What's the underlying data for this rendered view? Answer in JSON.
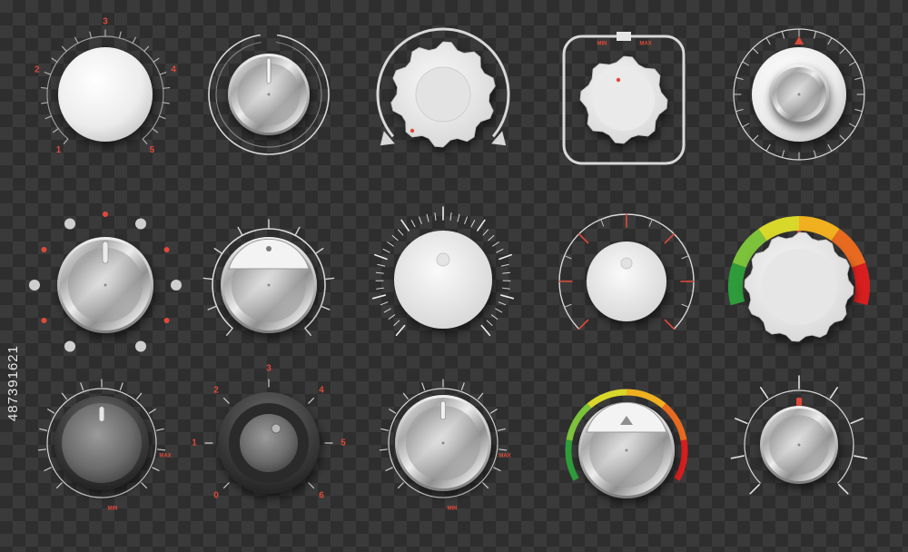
{
  "watermark": "487391621",
  "colors": {
    "accent_red": "#e04a3a",
    "ring": "#d8d8d8",
    "gauge": [
      "#2e9c3a",
      "#7cc23a",
      "#d8d82a",
      "#f0b020",
      "#e86a20",
      "#d81e1e"
    ]
  },
  "knobs": [
    {
      "id": "knob-1-1",
      "style": "white-numbered",
      "scale_labels": [
        "1",
        "2",
        "3",
        "4",
        "5"
      ]
    },
    {
      "id": "knob-1-2",
      "style": "chrome-ring-indicator"
    },
    {
      "id": "knob-1-3",
      "style": "white-gear-rotate-arrows"
    },
    {
      "id": "knob-1-4",
      "style": "white-gear-square-frame",
      "scale_labels": [
        "MIN",
        "MAX"
      ]
    },
    {
      "id": "knob-1-5",
      "style": "white-chrome-center-dial"
    },
    {
      "id": "knob-2-1",
      "style": "chrome-dots"
    },
    {
      "id": "knob-2-2",
      "style": "chrome-window"
    },
    {
      "id": "knob-2-3",
      "style": "white-fine-scale"
    },
    {
      "id": "knob-2-4",
      "style": "white-ticks-red"
    },
    {
      "id": "knob-2-5",
      "style": "white-gear-color-gauge"
    },
    {
      "id": "knob-3-1",
      "style": "dark-max-min",
      "scale_labels": [
        "MAX",
        "MIN"
      ]
    },
    {
      "id": "knob-3-2",
      "style": "dark-numbered",
      "scale_labels": [
        "0",
        "1",
        "2",
        "3",
        "4",
        "5",
        "6"
      ]
    },
    {
      "id": "knob-3-3",
      "style": "chrome-max-min",
      "scale_labels": [
        "MAX",
        "MIN"
      ]
    },
    {
      "id": "knob-3-4",
      "style": "chrome-color-gauge"
    },
    {
      "id": "knob-3-5",
      "style": "chrome-red-pointer"
    }
  ]
}
